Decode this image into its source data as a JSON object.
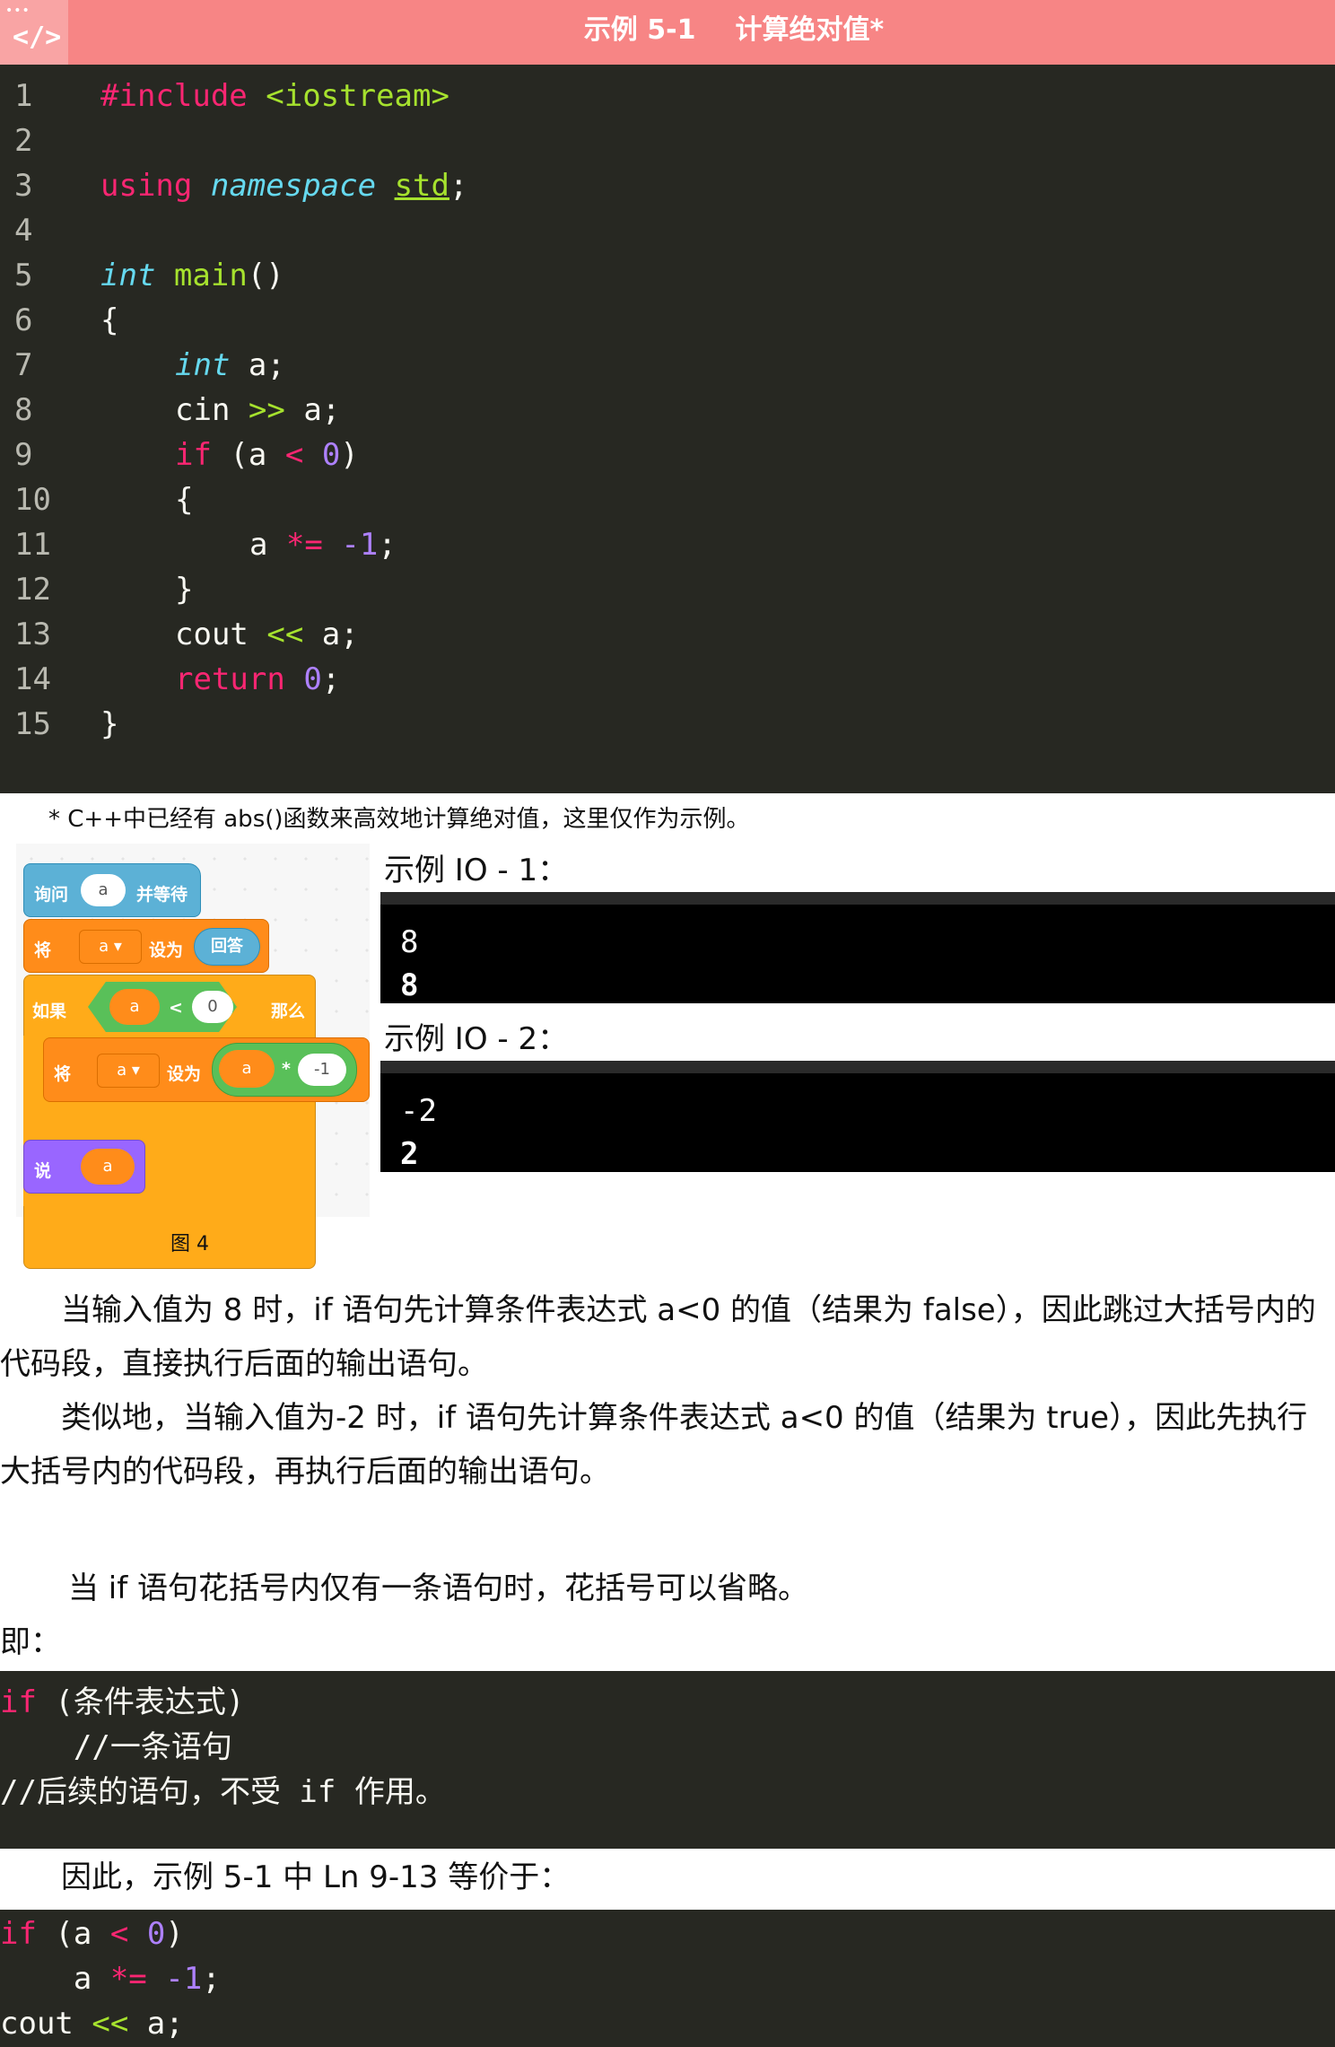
{
  "header": {
    "code_icon": "</>",
    "example_no": "示例 5-1",
    "title": "计算绝对值*"
  },
  "code": {
    "line_numbers": [
      "1",
      "2",
      "3",
      "4",
      "5",
      "6",
      "7",
      "8",
      "9",
      "10",
      "11",
      "12",
      "13",
      "14",
      "15"
    ],
    "include": "#include",
    "header_file": "<iostream>",
    "using": "using",
    "namespace": "namespace",
    "std": "std",
    "semicolon": ";",
    "int": "int",
    "main": "main",
    "parens": "()",
    "open_brace": "{",
    "close_brace": "}",
    "decl_a": " a;",
    "cin": "cin ",
    "shift_in": ">>",
    "if": "if",
    "cond_open": " (a ",
    "lt": "<",
    "zero": "0",
    "cond_close": ")",
    "a": "a ",
    "mul_assign": "*=",
    "neg_one": "-1",
    "cout": "cout ",
    "shift_out": "<<",
    "return": "return",
    "end_a": " a;"
  },
  "note": "* C++中已经有 abs()函数来高效地计算绝对值，这里仅作为示例。",
  "scratch": {
    "ask": "询问",
    "ask_var": "a",
    "and_wait": "并等待",
    "set": "将",
    "set_var": "a ▾",
    "set_to": "设为",
    "answer": "回答",
    "if": "如果",
    "cmp_left": "a",
    "cmp_op": "<",
    "cmp_right": "0",
    "then": "那么",
    "set2": "将",
    "set2_var": "a ▾",
    "set2_to": "设为",
    "mul_left": "a",
    "mul_op": "*",
    "mul_right": "-1",
    "say": "说",
    "say_var": "a"
  },
  "figure_caption": "图 4",
  "io": [
    {
      "label": "示例 IO - 1：",
      "input": "8",
      "output": "8"
    },
    {
      "label": "示例 IO - 2：",
      "input": "-2",
      "output": "2"
    }
  ],
  "paragraphs": {
    "p1": "当输入值为 8 时，if 语句先计算条件表达式 a<0 的值（结果为 false），因此跳过大括号内的代码段，直接执行后面的输出语句。",
    "p2": "类似地，当输入值为-2 时，if 语句先计算条件表达式 a<0 的值（结果为 true），因此先执行大括号内的代码段，再执行后面的输出语句。",
    "p3": "当 if 语句花括号内仅有一条语句时，花括号可以省略。",
    "p4": "即：",
    "p5": "因此，示例 5-1 中 Ln 9-13 等价于："
  },
  "snippet1": {
    "if": "if",
    "cond": " (条件表达式)",
    "line2": "    //一条语句",
    "line3": "//后续的语句，不受 if 作用。"
  },
  "snippet2": {
    "if": "if",
    "cond_open": " (a ",
    "lt": "<",
    "zero": "0",
    "cond_close": ")",
    "indent_a": "    a ",
    "mul_assign": "*=",
    "neg_one": "-1",
    "semi": ";",
    "cout": "cout ",
    "shift_out": "<<",
    "end_a": " a;"
  }
}
